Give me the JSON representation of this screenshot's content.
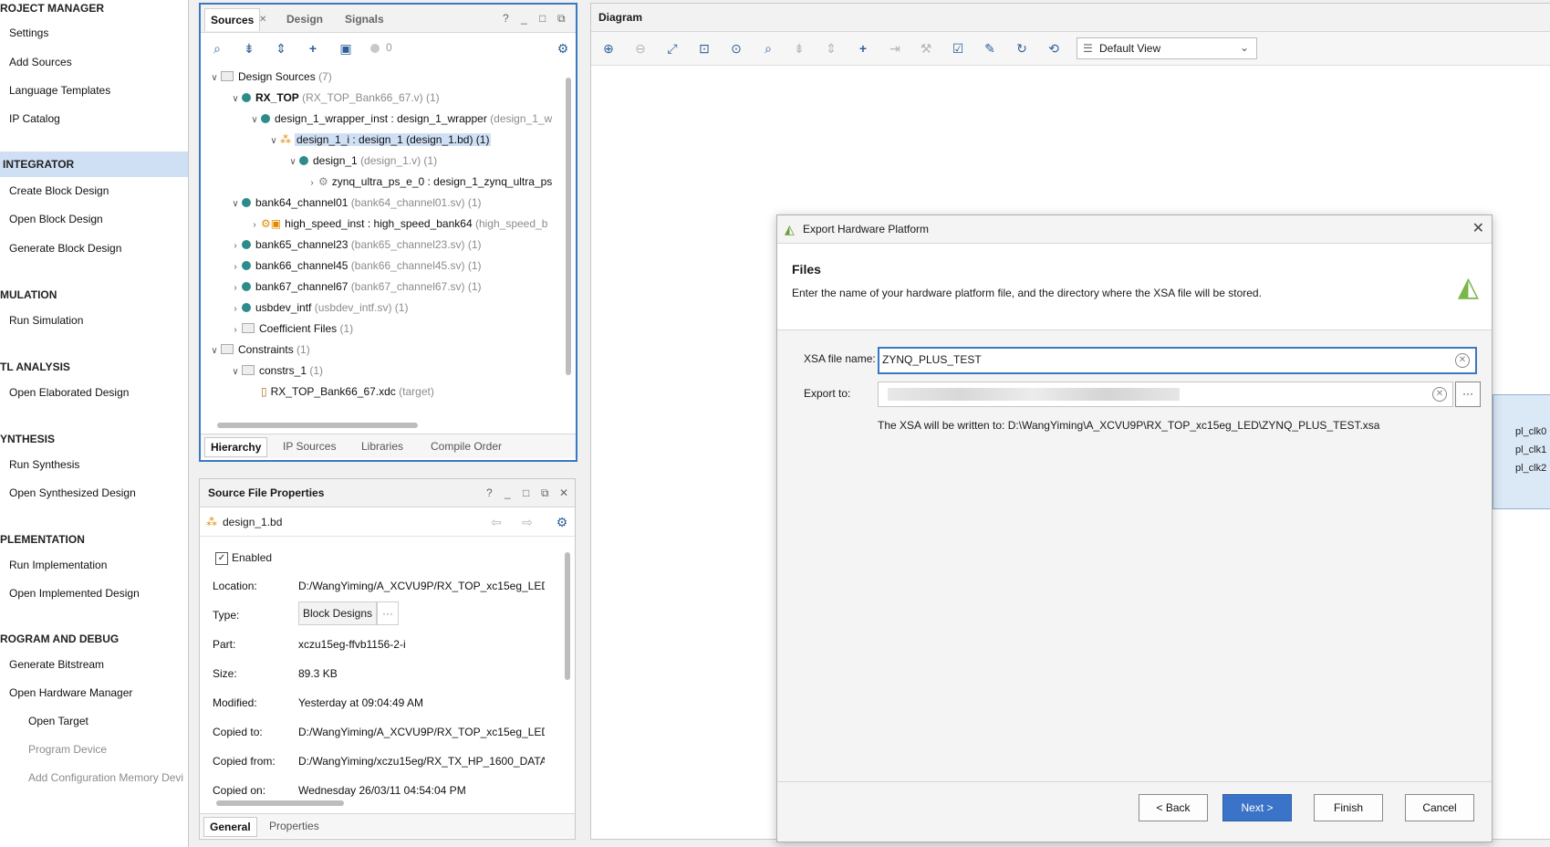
{
  "nav": {
    "sections": [
      {
        "label": "ROJECT MANAGER"
      },
      {
        "label": "INTEGRATOR"
      },
      {
        "label": "MULATION"
      },
      {
        "label": "TL ANALYSIS"
      },
      {
        "label": "YNTHESIS"
      },
      {
        "label": "PLEMENTATION"
      },
      {
        "label": "ROGRAM AND DEBUG"
      }
    ],
    "items": [
      {
        "label": "Settings"
      },
      {
        "label": "Add Sources"
      },
      {
        "label": "Language Templates"
      },
      {
        "label": "IP Catalog"
      },
      {
        "label": "Create Block Design"
      },
      {
        "label": "Open Block Design"
      },
      {
        "label": "Generate Block Design"
      },
      {
        "label": "Run Simulation"
      },
      {
        "label": "Open Elaborated Design"
      },
      {
        "label": "Run Synthesis"
      },
      {
        "label": "Open Synthesized Design"
      },
      {
        "label": "Run Implementation"
      },
      {
        "label": "Open Implemented Design"
      },
      {
        "label": "Generate Bitstream"
      },
      {
        "label": "Open Hardware Manager"
      },
      {
        "label": "Open Target"
      },
      {
        "label": "Program Device"
      },
      {
        "label": "Add Configuration Memory Devi"
      }
    ]
  },
  "sources": {
    "tabs": [
      "Sources",
      "Design",
      "Signals"
    ],
    "count": "0",
    "tree": [
      {
        "name": "Design Sources",
        "extra": "(7)"
      },
      {
        "name": "RX_TOP",
        "extra": "(RX_TOP_Bank66_67.v) (1)"
      },
      {
        "name": "design_1_wrapper_inst : design_1_wrapper",
        "extra": "(design_1_w"
      },
      {
        "name": "design_1_i : design_1 (design_1.bd) (1)",
        "extra": ""
      },
      {
        "name": "design_1",
        "extra": "(design_1.v) (1)"
      },
      {
        "name": "zynq_ultra_ps_e_0 : design_1_zynq_ultra_ps",
        "extra": ""
      },
      {
        "name": "bank64_channel01",
        "extra": "(bank64_channel01.sv) (1)"
      },
      {
        "name": "high_speed_inst : high_speed_bank64",
        "extra": "(high_speed_b"
      },
      {
        "name": "bank65_channel23",
        "extra": "(bank65_channel23.sv) (1)"
      },
      {
        "name": "bank66_channel45",
        "extra": "(bank66_channel45.sv) (1)"
      },
      {
        "name": "bank67_channel67",
        "extra": "(bank67_channel67.sv) (1)"
      },
      {
        "name": "usbdev_intf",
        "extra": "(usbdev_intf.sv) (1)"
      },
      {
        "name": "Coefficient Files",
        "extra": "(1)"
      },
      {
        "name": "Constraints",
        "extra": "(1)"
      },
      {
        "name": "constrs_1",
        "extra": "(1)"
      },
      {
        "name": "RX_TOP_Bank66_67.xdc",
        "extra": "(target)"
      }
    ],
    "bottom_tabs": [
      "Hierarchy",
      "IP Sources",
      "Libraries",
      "Compile Order"
    ]
  },
  "props": {
    "title": "Source File Properties",
    "file": "design_1.bd",
    "enabled_label": "Enabled",
    "type_button": "Block Designs",
    "rows": [
      {
        "label": "Location:",
        "value": "D:/WangYiming/A_XCVU9P/RX_TOP_xc15eg_LED."
      },
      {
        "label": "Type:",
        "value": ""
      },
      {
        "label": "Part:",
        "value": "xczu15eg-ffvb1156-2-i"
      },
      {
        "label": "Size:",
        "value": "89.3 KB"
      },
      {
        "label": "Modified:",
        "value": "Yesterday at 09:04:49 AM"
      },
      {
        "label": "Copied to:",
        "value": "D:/WangYiming/A_XCVU9P/RX_TOP_xc15eg_LED."
      },
      {
        "label": "Copied from:",
        "value": "D:/WangYiming/xczu15eg/RX_TX_HP_1600_DATA"
      },
      {
        "label": "Copied on:",
        "value": "Wednesday 26/03/11 04:54:04 PM"
      }
    ],
    "bottom_tabs": [
      "General",
      "Properties"
    ]
  },
  "diagram": {
    "title": "Diagram",
    "view_select": "Default View",
    "clk_labels": [
      "pl_clk0",
      "pl_clk1",
      "pl_clk2"
    ]
  },
  "dialog": {
    "title": "Export Hardware Platform",
    "heading": "Files",
    "description": "Enter the name of your hardware platform file, and the directory where the XSA file will be stored.",
    "xsa_label": "XSA file name:",
    "xsa_value": "ZYNQ_PLUS_TEST",
    "export_label": "Export to:",
    "export_value": "",
    "written_to": "The XSA will be written to: D:\\WangYiming\\A_XCVU9P\\RX_TOP_xc15eg_LED\\ZYNQ_PLUS_TEST.xsa",
    "buttons": {
      "back": "< Back",
      "next": "Next >",
      "finish": "Finish",
      "cancel": "Cancel"
    }
  }
}
